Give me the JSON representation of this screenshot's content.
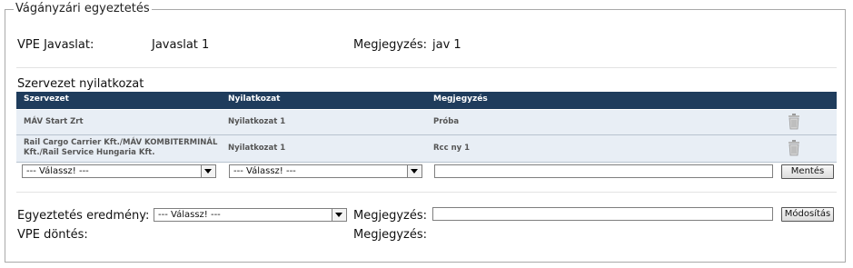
{
  "panel": {
    "title": "Vágányzári egyeztetés"
  },
  "proposal": {
    "label": "VPE Javaslat:",
    "value": "Javaslat 1",
    "note_label": "Megjegyzés:",
    "note_value": "jav 1"
  },
  "org_section": {
    "title": "Szervezet nyilatkozat"
  },
  "table": {
    "headers": [
      "Szervezet",
      "Nyilatkozat",
      "Megjegyzés",
      ""
    ],
    "rows": [
      {
        "org": "MÁV Start Zrt",
        "statement": "Nyilatkozat 1",
        "note": "Próba",
        "action_icon": "trash-icon"
      },
      {
        "org": "Rail Cargo Carrier Kft./MÁV KOMBITERMINÁL Kft./Rail Service Hungaria Kft.",
        "statement": "Nyilatkozat 1",
        "note": "Rcc ny 1",
        "action_icon": "trash-icon"
      }
    ]
  },
  "new_row": {
    "org_select": "--- Válassz! ---",
    "statement_select": "--- Válassz! ---",
    "note_input": "",
    "save_button": "Mentés"
  },
  "result": {
    "label": "Egyeztetés eredmény:",
    "select": "--- Válassz! ---",
    "note_label": "Megjegyzés:",
    "note_input": "",
    "modify_button": "Módosítás"
  },
  "decision": {
    "label": "VPE döntés:",
    "note_label": "Megjegyzés:"
  },
  "colors": {
    "header_bg": "#1f3c5c",
    "row_bg": "#e8eef5",
    "border": "#a9a9a9"
  }
}
